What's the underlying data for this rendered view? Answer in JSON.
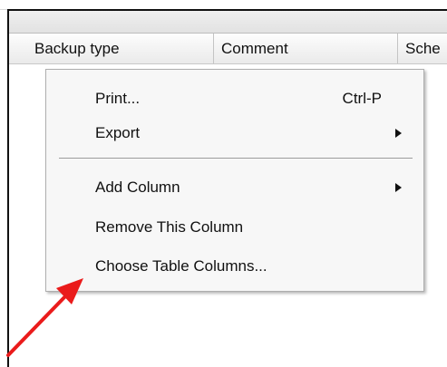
{
  "table": {
    "columns": [
      "Backup type",
      "Comment",
      "Sche"
    ]
  },
  "context_menu": {
    "items": [
      {
        "label": "Print...",
        "shortcut": "Ctrl-P"
      },
      {
        "label": "Export"
      },
      {
        "label": "Add Column"
      },
      {
        "label": "Remove This Column"
      },
      {
        "label": "Choose Table Columns..."
      }
    ]
  },
  "annotation": {
    "arrow_color": "#ea1b1b",
    "icon": "red-arrow-icon"
  }
}
